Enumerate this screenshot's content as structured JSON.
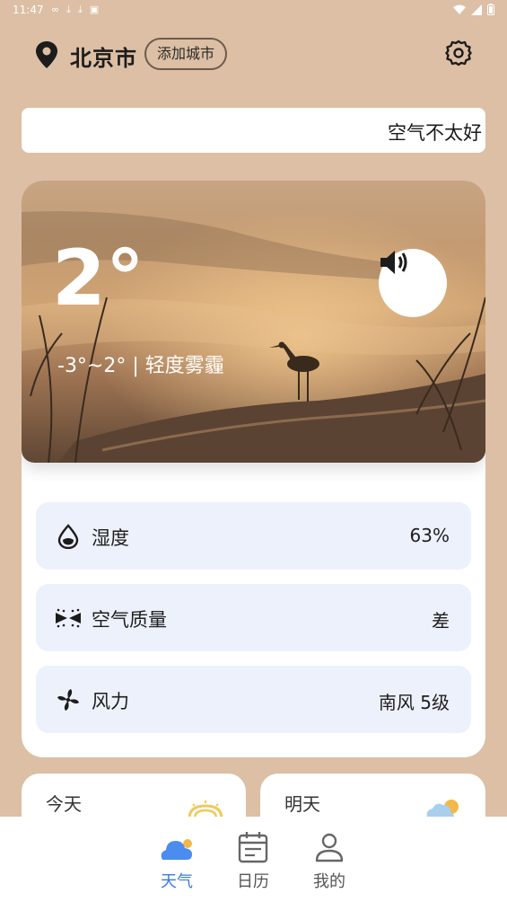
{
  "status_bar": {
    "time": "11:47"
  },
  "header": {
    "city": "北京市",
    "add_city_label": "添加城市"
  },
  "banner": {
    "text": "空气不太好"
  },
  "weather": {
    "temperature": "2°",
    "range_text": "-3°~2°  |  轻度雾霾"
  },
  "details": [
    {
      "label": "湿度",
      "value": "63%",
      "icon": "humidity-drop-icon"
    },
    {
      "label": "空气质量",
      "value": "差",
      "icon": "air-quality-icon"
    },
    {
      "label": "风力",
      "value": "南风  5级",
      "icon": "wind-fan-icon"
    }
  ],
  "forecast": {
    "today": {
      "label": "今天",
      "icon": "sunny-icon"
    },
    "tomorrow": {
      "label": "明天",
      "icon": "partly-cloudy-icon"
    }
  },
  "nav": [
    {
      "label": "天气",
      "icon": "cloud-icon",
      "active": true
    },
    {
      "label": "日历",
      "icon": "calendar-icon",
      "active": false
    },
    {
      "label": "我的",
      "icon": "profile-icon",
      "active": false
    }
  ],
  "colors": {
    "accent": "#3a79e6",
    "background": "#dcbfa4",
    "row_bg": "#edf1fc"
  }
}
